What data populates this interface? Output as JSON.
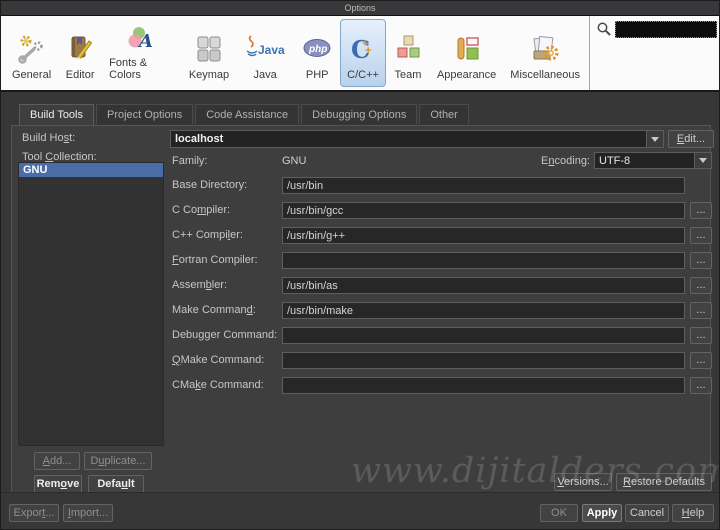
{
  "window": {
    "title": "Options"
  },
  "toolbar": {
    "categories": [
      {
        "label": "General"
      },
      {
        "label": "Editor"
      },
      {
        "label": "Fonts & Colors"
      },
      {
        "label": "Keymap"
      },
      {
        "label": "Java"
      },
      {
        "label": "PHP"
      },
      {
        "label": "C/C++"
      },
      {
        "label": "Team"
      },
      {
        "label": "Appearance"
      },
      {
        "label": "Miscellaneous"
      }
    ],
    "selected_category": "C/C++",
    "search": {
      "value": ""
    }
  },
  "tabs": [
    {
      "label": "Build Tools"
    },
    {
      "label": "Project Options"
    },
    {
      "label": "Code Assistance"
    },
    {
      "label": "Debugging Options"
    },
    {
      "label": "Other"
    }
  ],
  "panel": {
    "build_host_label": {
      "pre": "Build Ho",
      "mn": "s",
      "post": "t:"
    },
    "tool_collection_label": {
      "pre": "Tool ",
      "mn": "C",
      "post": "ollection:"
    },
    "tool_collections": [
      {
        "name": "GNU"
      }
    ],
    "host": {
      "value": "localhost"
    },
    "edit_button": {
      "pre": "",
      "mn": "E",
      "post": "dit..."
    },
    "family_label": "Family:",
    "family_value": "GNU",
    "encoding_label": {
      "pre": "E",
      "mn": "n",
      "post": "coding:"
    },
    "encoding_value": "UTF-8",
    "browse_label": "...",
    "rows": [
      {
        "label": {
          "pre": "Base Directory:",
          "mn": "",
          "post": ""
        },
        "value": "/usr/bin"
      },
      {
        "label": {
          "pre": "C Co",
          "mn": "m",
          "post": "piler:"
        },
        "value": "/usr/bin/gcc"
      },
      {
        "label": {
          "pre": "C++ Compi",
          "mn": "l",
          "post": "er:"
        },
        "value": "/usr/bin/g++"
      },
      {
        "label": {
          "pre": "",
          "mn": "F",
          "post": "ortran Compiler:"
        },
        "value": ""
      },
      {
        "label": {
          "pre": "Assem",
          "mn": "b",
          "post": "ler:"
        },
        "value": "/usr/bin/as"
      },
      {
        "label": {
          "pre": "Make Comman",
          "mn": "d",
          "post": ":"
        },
        "value": "/usr/bin/make"
      },
      {
        "label": {
          "pre": "Debu",
          "mn": "g",
          "post": "ger Command:"
        },
        "value": ""
      },
      {
        "label": {
          "pre": "",
          "mn": "Q",
          "post": "Make Command:"
        },
        "value": ""
      },
      {
        "label": {
          "pre": "CMa",
          "mn": "k",
          "post": "e Command:"
        },
        "value": ""
      }
    ],
    "list_buttons": {
      "add": {
        "pre": "",
        "mn": "A",
        "post": "dd..."
      },
      "duplicate": {
        "pre": "D",
        "mn": "u",
        "post": "plicate..."
      },
      "remove": {
        "pre": "Rem",
        "mn": "o",
        "post": "ve"
      },
      "default": {
        "pre": "Defa",
        "mn": "u",
        "post": "lt"
      }
    },
    "versions_button": {
      "pre": "",
      "mn": "V",
      "post": "ersions..."
    },
    "restore_defaults_button": {
      "pre": "",
      "mn": "R",
      "post": "estore Defaults"
    }
  },
  "footer": {
    "export_button": {
      "pre": "Expor",
      "mn": "t",
      "post": "..."
    },
    "import_button": {
      "pre": "",
      "mn": "I",
      "post": "mport..."
    },
    "ok_button": "OK",
    "apply_button": "Apply",
    "cancel_button": "Cancel",
    "help_button": {
      "pre": "",
      "mn": "H",
      "post": "elp"
    }
  },
  "watermark": "www.dijitalders.com",
  "colors": {
    "selection_blue": "#4a6da8",
    "selected_category_border": "#87a7c9",
    "selected_category_bg": "#c5d9ee"
  }
}
